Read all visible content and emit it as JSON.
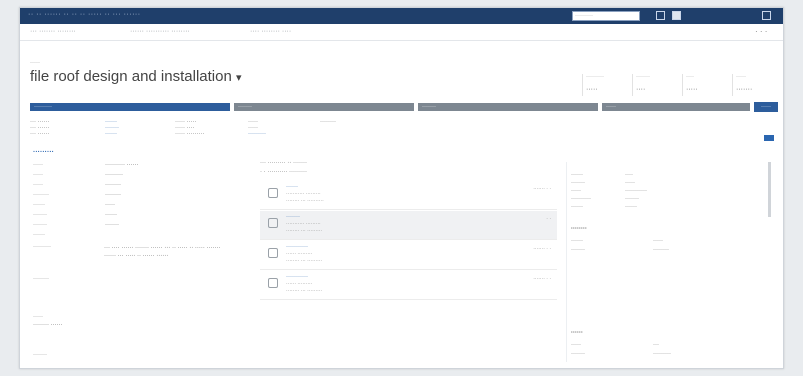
{
  "top_bar": {
    "app_name": "·· ·· ······ ·· ·· ·· ····· ·· ··· ······",
    "search_placeholder": "·········"
  },
  "nav": {
    "items": [
      "··· ······· ········",
      "······ ·········· ········",
      "···· ········ ····"
    ],
    "right": "· · ·"
  },
  "record": {
    "type_label": "·····",
    "title": "file roof design and installation",
    "title_chevron": "▾"
  },
  "kpis": [
    {
      "label": "·········",
      "value": "·····"
    },
    {
      "label": "·······",
      "value": "····"
    },
    {
      "label": "····",
      "value": "·····"
    },
    {
      "label": "·····",
      "value": "·······"
    }
  ],
  "process": {
    "stages": [
      "·········",
      "·······",
      "·······",
      "·····",
      "·····"
    ],
    "button": "·····"
  },
  "summary": {
    "col1": [
      "··· ······",
      "··· ······",
      "··· ······"
    ],
    "col2": [
      "······",
      "·······",
      "······"
    ],
    "col3": [
      "····· ·····",
      "····· ····",
      "····· ·········"
    ],
    "col4": [
      "·····",
      "·····",
      "·········"
    ],
    "col5": [
      "········",
      "",
      ""
    ]
  },
  "section_title": "·········",
  "fields": [
    {
      "label": "·····",
      "value": "·········· ······"
    },
    {
      "label": "·····",
      "value": "·········"
    },
    {
      "label": "·····",
      "value": "········"
    },
    {
      "label": "········",
      "value": "········"
    },
    {
      "label": "······",
      "value": "·····"
    },
    {
      "label": "·······",
      "value": "······"
    },
    {
      "label": "·······",
      "value": "·······"
    },
    {
      "label": "······",
      "value": ""
    }
  ],
  "description_label": "·········",
  "description_text": "··· ···· ······ ······· ······ ··· ·· ····· ·· ····· ······· ······ ··· ····· ·· ······ ······",
  "left_labels": [
    "········",
    "·····",
    "········ ······",
    "·······"
  ],
  "mid_header": {
    "line1": "··· ········· ·· ·······",
    "line2": "· · ·········· ·········"
  },
  "activities": [
    {
      "title": "······",
      "sub1": "··········· ·········",
      "sub2": "········ ··· ··········",
      "right": "······· · ·"
    },
    {
      "title": "·······",
      "sub1": "··········· ·········",
      "sub2": "········ ··· ·········",
      "right": "· ·"
    },
    {
      "title": "···········",
      "sub1": "······ ·········",
      "sub2": "········ ··· ·········",
      "right": "······· · ·"
    },
    {
      "title": "···········",
      "sub1": "······ ·········",
      "sub2": "········ ··· ·········",
      "right": "······· · ·"
    }
  ],
  "right_panel": {
    "rows": [
      {
        "label": "······",
        "value": "····"
      },
      {
        "label": "·······",
        "value": "·····"
      },
      {
        "label": "·····",
        "value": "···········"
      },
      {
        "label": "··········",
        "value": "·······"
      },
      {
        "label": "······",
        "value": "······"
      }
    ],
    "section2_title": "········",
    "section2_rows": [
      {
        "label": "······",
        "value": "·····"
      },
      {
        "label": "·······",
        "value": "········"
      }
    ],
    "section3_title": "······",
    "section3_rows": [
      {
        "label": "·····",
        "value": "···"
      },
      {
        "label": "·······",
        "value": "·········"
      }
    ]
  }
}
